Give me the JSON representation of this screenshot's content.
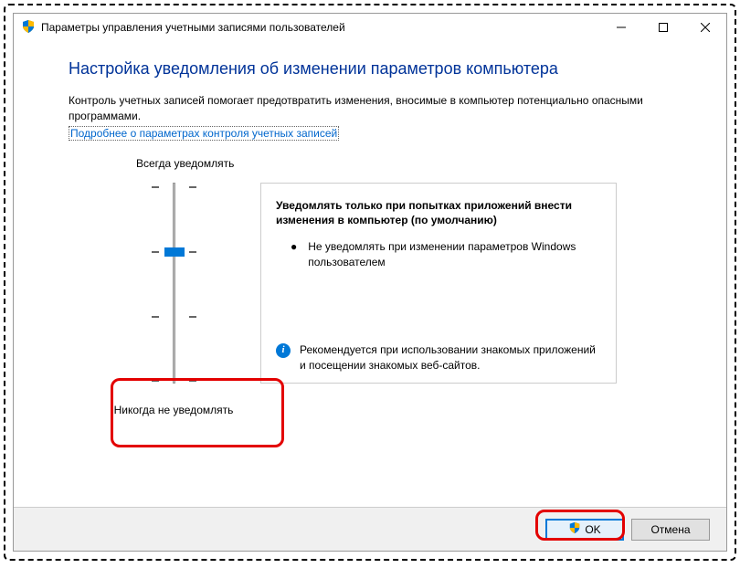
{
  "window": {
    "title": "Параметры управления учетными записями пользователей"
  },
  "heading": "Настройка уведомления об изменении параметров компьютера",
  "description": "Контроль учетных записей помогает предотвратить изменения, вносимые в компьютер потенциально опасными программами.",
  "link": "Подробнее о параметрах контроля учетных записей",
  "slider": {
    "top_label": "Всегда уведомлять",
    "bottom_label": "Никогда не уведомлять",
    "position": 1,
    "levels": 4
  },
  "info": {
    "title": "Уведомлять только при попытках приложений внести изменения в компьютер (по умолчанию)",
    "bullet": "Не уведомлять при изменении параметров Windows пользователем",
    "recommendation": "Рекомендуется при использовании знакомых приложений и посещении знакомых веб-сайтов."
  },
  "buttons": {
    "ok": "OK",
    "cancel": "Отмена"
  },
  "icons": {
    "info_char": "i"
  }
}
